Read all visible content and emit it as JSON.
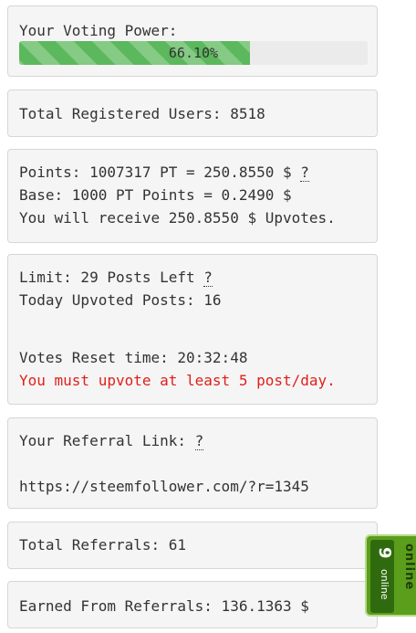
{
  "voting_power": {
    "label": "Your Voting Power:",
    "percent": 66.1,
    "percent_text": "66.10%",
    "bar_color": "#5cb85c"
  },
  "users": {
    "text": "Total Registered Users: 8518"
  },
  "points": {
    "line1": "Points: 1007317 PT = 250.8550 $",
    "help": "?",
    "line2": "Base: 1000 PT Points = 0.2490 $",
    "line3": "You will receive 250.8550 $ Upvotes."
  },
  "limit": {
    "line1": "Limit: 29 Posts Left",
    "help": "?",
    "line2": "Today Upvoted Posts: 16",
    "reset": "Votes Reset time: 20:32:48",
    "warning": "You must upvote at least 5 post/day.",
    "warning_color": "#e0201b"
  },
  "referral": {
    "label": "Your Referral Link:",
    "help": "?",
    "link": "https://steemfollower.com/?r=1345"
  },
  "referrals_total": {
    "text": "Total Referrals: 61"
  },
  "earned": {
    "text": "Earned From Referrals: 136.1363 $"
  },
  "online_widget": {
    "count": "9",
    "label": "online",
    "side_label": "online",
    "icon": "online-counter-icon"
  }
}
